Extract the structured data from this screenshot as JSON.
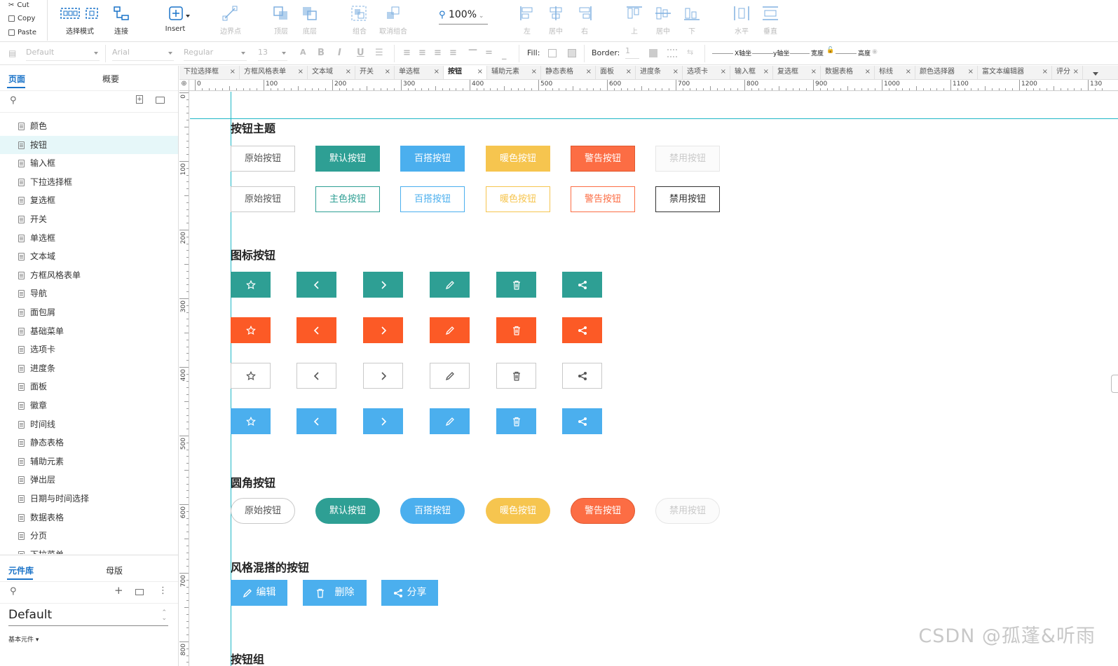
{
  "toolbar": {
    "cut": "Cut",
    "copy": "Copy",
    "paste": "Paste",
    "select_mode": "选择模式",
    "connect": "连接",
    "insert": "Insert",
    "boundary": "边界点",
    "top_layer": "顶层",
    "bottom_layer": "底层",
    "group": "组合",
    "ungroup": "取消组合",
    "zoom": "100%",
    "align_left": "左",
    "align_center": "居中",
    "align_right": "右",
    "align_top": "上",
    "align_middle": "居中",
    "align_bottom": "下",
    "dist_h": "水平",
    "dist_v": "垂直"
  },
  "format": {
    "style": "Default",
    "font": "Arial",
    "weight": "Regular",
    "size": "13",
    "fill_label": "Fill:",
    "border_label": "Border:",
    "border_value": "1",
    "x_label": "X轴坐",
    "y_label": "y轴坐",
    "w_label": "宽度",
    "h_label": "高度"
  },
  "left_panel": {
    "tab_pages": "页面",
    "tab_outline": "概要",
    "pages": [
      "颜色",
      "按钮",
      "输入框",
      "下拉选择框",
      "复选框",
      "开关",
      "单选框",
      "文本域",
      "方框风格表单",
      "导航",
      "面包屑",
      "基础菜单",
      "选项卡",
      "进度条",
      "面板",
      "徽章",
      "时间线",
      "静态表格",
      "辅助元素",
      "弹出层",
      "日期与时间选择",
      "数据表格",
      "分页",
      "下拉菜单"
    ],
    "selected_page": "按钮",
    "tab_library": "元件库",
    "tab_masters": "母版",
    "library_name": "Default",
    "library_sub": "基本元件 ▾"
  },
  "doc_tabs": [
    "下拉选择框",
    "方框风格表单",
    "文本域",
    "开关",
    "单选框",
    "按钮",
    "辅助元素",
    "静态表格",
    "面板",
    "进度条",
    "选项卡",
    "输入框",
    "复选框",
    "数据表格",
    "标线",
    "颜色选择器",
    "富文本编辑器",
    "评分"
  ],
  "active_tab": "按钮",
  "ruler": {
    "h": [
      "0",
      "100",
      "200",
      "300",
      "400",
      "500",
      "600",
      "700",
      "800",
      "900",
      "1000",
      "1100",
      "1200",
      "130"
    ],
    "v": [
      "0",
      "100",
      "200",
      "300",
      "400",
      "500",
      "600",
      "700",
      "800"
    ]
  },
  "canvas": {
    "section1": "按钮主题",
    "row1": [
      "原始按钮",
      "默认按钮",
      "百搭按钮",
      "暖色按钮",
      "警告按钮",
      "禁用按钮"
    ],
    "row2": [
      "原始按钮",
      "主色按钮",
      "百搭按钮",
      "暖色按钮",
      "警告按钮",
      "禁用按钮"
    ],
    "section2": "图标按钮",
    "section3": "圆角按钮",
    "row3": [
      "原始按钮",
      "默认按钮",
      "百搭按钮",
      "暖色按钮",
      "警告按钮",
      "禁用按钮"
    ],
    "section4": "风格混搭的按钮",
    "mix": [
      "编辑",
      "删除",
      "分享"
    ],
    "section5": "按钮组"
  },
  "colors": {
    "teal": "#2e9f94",
    "blue": "#4bafee",
    "warm": "#f6c54f",
    "warn": "#fc6d44",
    "orange": "#fc5a26",
    "accent": "#1a73c8"
  },
  "watermark": "CSDN @孤蓬&听雨"
}
